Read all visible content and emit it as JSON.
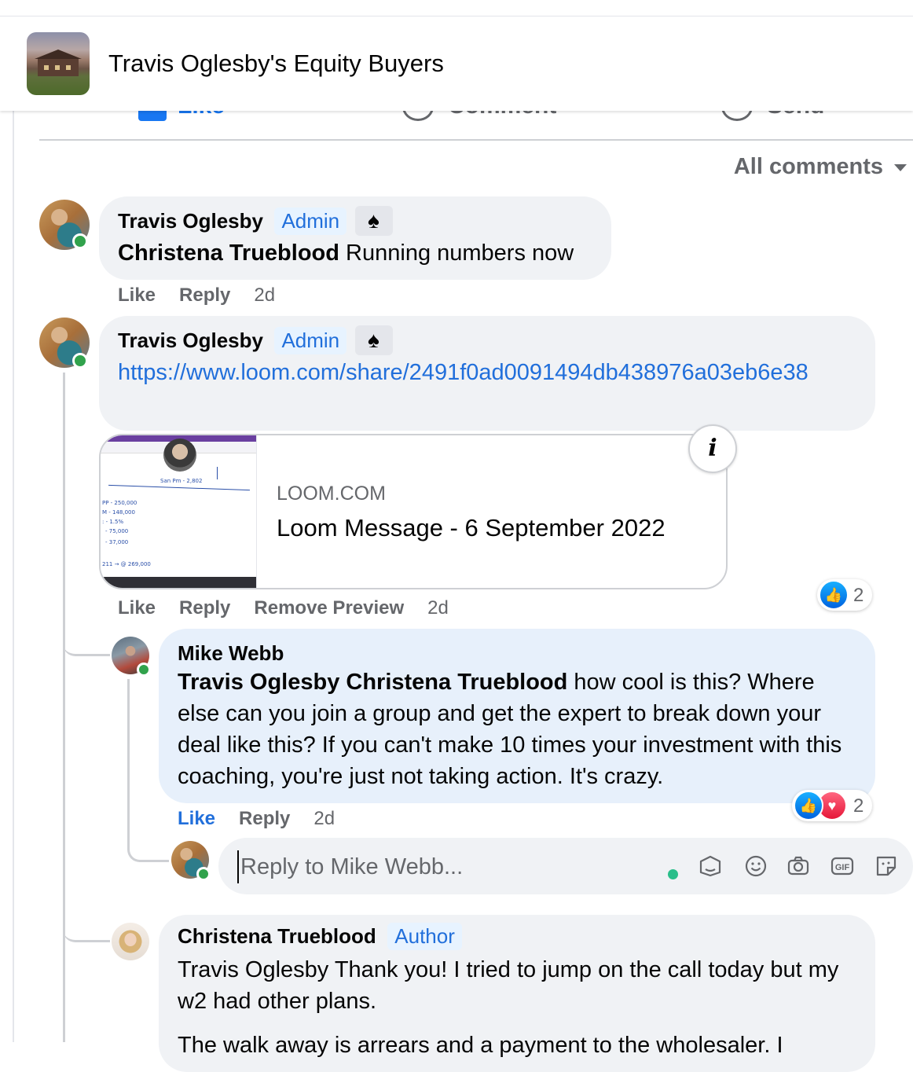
{
  "header": {
    "group_name": "Travis Oglesby's Equity Buyers"
  },
  "post_actions": {
    "like": "Like",
    "comment": "Comment",
    "send": "Send"
  },
  "comments_filter": "All comments",
  "comments": [
    {
      "author": "Travis Oglesby",
      "badge": "Admin",
      "mention": "Christena Trueblood",
      "text": "Running numbers now",
      "actions": {
        "like": "Like",
        "reply": "Reply",
        "time": "2d"
      }
    },
    {
      "author": "Travis Oglesby",
      "badge": "Admin",
      "link": "https://www.loom.com/share/2491f0ad0091494db438976a03eb6e38",
      "preview": {
        "domain": "LOOM.COM",
        "title": "Loom Message - 6 September 2022"
      },
      "actions": {
        "like": "Like",
        "reply": "Reply",
        "remove_preview": "Remove Preview",
        "time": "2d"
      },
      "reactions": {
        "count": "2",
        "types": [
          "like"
        ]
      }
    }
  ],
  "reply": {
    "author": "Mike Webb",
    "mention": "Travis Oglesby Christena Trueblood",
    "text": "how cool is this? Where else can you join a group and get the expert to break down your deal like this? If you can't make 10 times your investment with this coaching, you're just not taking action. It's crazy.",
    "actions": {
      "like": "Like",
      "reply": "Reply",
      "time": "2d"
    },
    "reactions": {
      "count": "2",
      "types": [
        "like",
        "love"
      ]
    }
  },
  "reply_box": {
    "placeholder": "Reply to Mike Webb...",
    "tools": [
      "avatar-sticker-icon",
      "emoji-icon",
      "camera-icon",
      "gif-icon",
      "sticker-icon"
    ]
  },
  "third_comment": {
    "author": "Christena Trueblood",
    "badge": "Author",
    "line1": "Travis Oglesby Thank you! I tried to jump on the call today but my w2 had other plans.",
    "line2": "The walk away is arrears and a payment to the wholesaler. I"
  },
  "colors": {
    "accent": "#216fdb",
    "bubble": "#f0f2f5",
    "highlight_bubble": "#e7f0fb",
    "online": "#31a24c"
  }
}
